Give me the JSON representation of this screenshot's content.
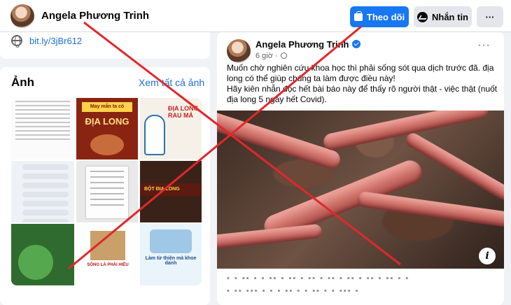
{
  "profile": {
    "name": "Angela Phương Trinh",
    "follow_label": "Theo dõi",
    "message_label": "Nhắn tin",
    "more_label": "···"
  },
  "intro": {
    "link": "bit.ly/3jBr612"
  },
  "photos": {
    "title": "Ảnh",
    "see_all": "Xem tất cả ảnh",
    "tiles": {
      "t2_caption": "May mắn ta có",
      "t2_title": "ĐỊA LONG",
      "t3_text": "ĐỊA LONG RAU MÁ",
      "t6_text": "BỘT ĐỊA LONG",
      "t8_caption": "SỐNG LÀ PHẢI HIỂU",
      "t9_caption": "Làm từ thiện mà khoe danh"
    }
  },
  "post": {
    "author": "Angela Phương Trinh",
    "time": "6 giờ ·",
    "more": "···",
    "text_lines": [
      "Muốn chờ nghiên cứu khoa học thì phải sống sót qua dịch trước đã. địa long có thể giúp chúng ta làm được điều này!",
      "Hãy kiên nhẫn đọc hết bài báo này để thấy rõ người thật - việc thật (nuốt địa long 5 ngày hết Covid)."
    ],
    "info_icon": "i",
    "blurred_line1": "▪ ▪ ▪▪ ▪ ▪ ▪▪ ▪ ▪▪ ▪ ▪▪ ▪ ▪▪ ▪ ▪▪ ▪ ▪▪ ▪ ▪▪ ▪ ▪",
    "blurred_line2": "  ▪   ▪▪ ▪▪▪ ▪ ▪ ▪  ▪▪ ▪  ▪ ▪▪ ▪ ▪  ▪▪▪ ▪"
  },
  "colors": {
    "accent": "#1877f2",
    "overlay_x": "#e0282c"
  },
  "icons": [
    "bag-icon",
    "messenger-icon",
    "globe-icon",
    "verified-icon",
    "info-icon"
  ]
}
